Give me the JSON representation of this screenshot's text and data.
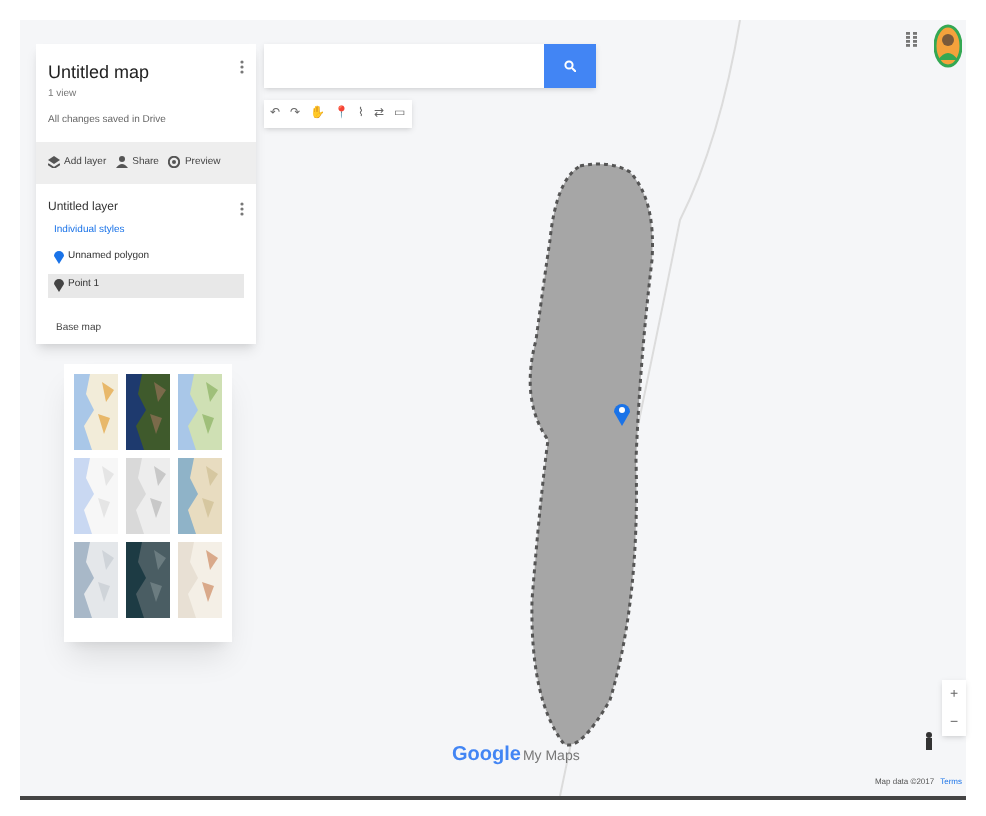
{
  "panel": {
    "title": "Untitled map",
    "views": "1 view",
    "status": "All changes saved in Drive",
    "actions": [
      {
        "label": "Add layer",
        "kind": "layer"
      },
      {
        "label": "Share",
        "kind": "share"
      },
      {
        "label": "Preview",
        "kind": "preview"
      }
    ],
    "layer": {
      "title": "Untitled layer",
      "style": "Individual styles",
      "items": [
        {
          "label": "Unnamed polygon",
          "kind": "marker",
          "selected": false
        },
        {
          "label": "Point 1",
          "kind": "pin",
          "selected": true
        }
      ]
    },
    "basemap": {
      "label": "Base map"
    }
  },
  "basemaps": [
    {
      "kind": "map",
      "selected": false
    },
    {
      "kind": "satellite",
      "selected": false
    },
    {
      "kind": "terrain",
      "selected": false
    },
    {
      "kind": "light",
      "selected": false
    },
    {
      "kind": "mono",
      "selected": false
    },
    {
      "kind": "atlas",
      "selected": false
    },
    {
      "kind": "grey",
      "selected": false
    },
    {
      "kind": "dark",
      "selected": false
    },
    {
      "kind": "vintage",
      "selected": false
    }
  ],
  "tools": [
    "↶",
    "↷",
    "✋",
    "📍",
    "⌇",
    "⇄",
    "▭"
  ],
  "footer": {
    "logo_google": "Google",
    "logo_product": "My Maps",
    "attribution": "Map data ©2017",
    "terms": "Terms"
  },
  "zoom": [
    "+",
    "−"
  ]
}
